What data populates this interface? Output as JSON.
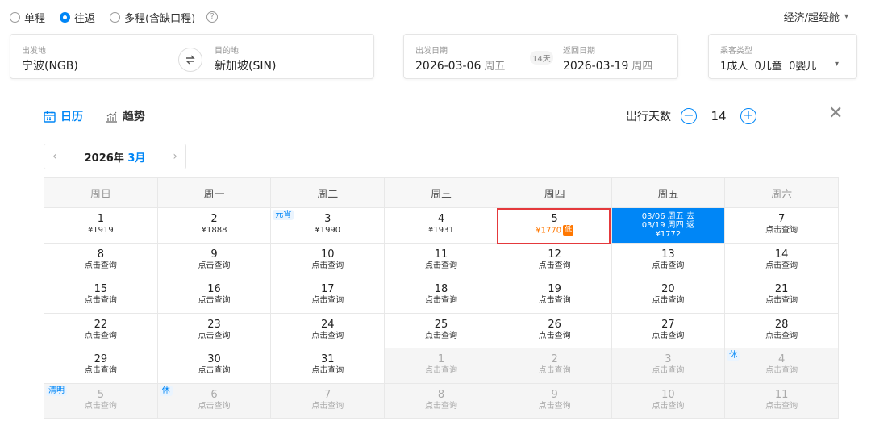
{
  "trip_types": [
    {
      "label": "单程",
      "selected": false
    },
    {
      "label": "往返",
      "selected": true
    },
    {
      "label": "多程(含缺口程)",
      "selected": false
    }
  ],
  "cabin": "经济/超经舱",
  "origin": {
    "label": "出发地",
    "value": "宁波(NGB)"
  },
  "destination": {
    "label": "目的地",
    "value": "新加坡(SIN)"
  },
  "depart": {
    "label": "出发日期",
    "date": "2026-03-06",
    "weekday": "周五"
  },
  "return": {
    "label": "返回日期",
    "date": "2026-03-19",
    "weekday": "周四"
  },
  "days_pill": "14天",
  "passengers": {
    "label": "乘客类型",
    "value": "1成人  0儿童  0婴儿"
  },
  "tabs": [
    {
      "label": "日历",
      "active": true
    },
    {
      "label": "趋势",
      "active": false
    }
  ],
  "trip_days": {
    "label": "出行天数",
    "value": "14",
    "minus": "−",
    "plus": "+"
  },
  "month_nav": {
    "year": "2026年",
    "month": "3月",
    "prev": "‹",
    "next": "›"
  },
  "weekdays": [
    "周日",
    "周一",
    "周二",
    "周三",
    "周四",
    "周五",
    "周六"
  ],
  "calendar": [
    [
      {
        "day": "1",
        "price": "¥1919"
      },
      {
        "day": "2",
        "price": "¥1888"
      },
      {
        "day": "3",
        "price": "¥1990",
        "badge": "元宵"
      },
      {
        "day": "4",
        "price": "¥1931"
      },
      {
        "day": "5",
        "price": "¥1770",
        "low": "低"
      },
      {
        "selected": [
          "03/06 周五 去",
          "03/19 周四 返",
          "¥1772"
        ]
      },
      {
        "day": "7",
        "price": "点击查询"
      }
    ],
    [
      {
        "day": "8",
        "price": "点击查询"
      },
      {
        "day": "9",
        "price": "点击查询"
      },
      {
        "day": "10",
        "price": "点击查询"
      },
      {
        "day": "11",
        "price": "点击查询"
      },
      {
        "day": "12",
        "price": "点击查询"
      },
      {
        "day": "13",
        "price": "点击查询"
      },
      {
        "day": "14",
        "price": "点击查询"
      }
    ],
    [
      {
        "day": "15",
        "price": "点击查询"
      },
      {
        "day": "16",
        "price": "点击查询"
      },
      {
        "day": "17",
        "price": "点击查询"
      },
      {
        "day": "18",
        "price": "点击查询"
      },
      {
        "day": "19",
        "price": "点击查询"
      },
      {
        "day": "20",
        "price": "点击查询"
      },
      {
        "day": "21",
        "price": "点击查询"
      }
    ],
    [
      {
        "day": "22",
        "price": "点击查询"
      },
      {
        "day": "23",
        "price": "点击查询"
      },
      {
        "day": "24",
        "price": "点击查询"
      },
      {
        "day": "25",
        "price": "点击查询"
      },
      {
        "day": "26",
        "price": "点击查询"
      },
      {
        "day": "27",
        "price": "点击查询"
      },
      {
        "day": "28",
        "price": "点击查询"
      }
    ],
    [
      {
        "day": "29",
        "price": "点击查询"
      },
      {
        "day": "30",
        "price": "点击查询"
      },
      {
        "day": "31",
        "price": "点击查询"
      },
      {
        "day": "1",
        "price": "点击查询",
        "other": true
      },
      {
        "day": "2",
        "price": "点击查询",
        "other": true
      },
      {
        "day": "3",
        "price": "点击查询",
        "other": true
      },
      {
        "day": "4",
        "price": "点击查询",
        "other": true,
        "badge": "休"
      }
    ],
    [
      {
        "day": "5",
        "price": "点击查询",
        "other": true,
        "badge": "清明"
      },
      {
        "day": "6",
        "price": "点击查询",
        "other": true,
        "badge": "休"
      },
      {
        "day": "7",
        "price": "点击查询",
        "other": true
      },
      {
        "day": "8",
        "price": "点击查询",
        "other": true
      },
      {
        "day": "9",
        "price": "点击查询",
        "other": true
      },
      {
        "day": "10",
        "price": "点击查询",
        "other": true
      },
      {
        "day": "11",
        "price": "点击查询",
        "other": true
      }
    ]
  ],
  "colors": {
    "accent": "#0086f6",
    "low_price": "#ff7700",
    "highlight_border": "#e4393c"
  }
}
